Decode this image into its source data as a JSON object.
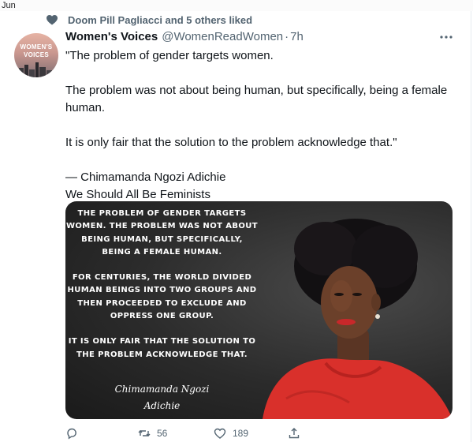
{
  "topbar": {
    "label": "Jun"
  },
  "social_context": {
    "icon": "heart-icon",
    "text": "Doom Pill Pagliacci and 5 others liked"
  },
  "avatar": {
    "title_line1": "WOMEN'S",
    "title_line2": "VOICES"
  },
  "tweet": {
    "author_name": "Women's Voices",
    "handle": "@WomenReadWomen",
    "separator": "·",
    "time": "7h",
    "paragraphs": [
      "\"The problem of gender targets women.",
      "The problem was not about being human, but specifically, being a female human.",
      "It is only fair that the solution to the problem acknowledge that.\"",
      "— Chimamanda Ngozi Adichie",
      "We Should All Be Feminists"
    ]
  },
  "media": {
    "quote_lines": [
      "THE PROBLEM OF GENDER TARGETS WOMEN. THE PROBLEM WAS NOT ABOUT BEING HUMAN, BUT SPECIFICALLY, BEING A FEMALE HUMAN.",
      "FOR CENTURIES, THE WORLD DIVIDED HUMAN BEINGS INTO TWO GROUPS AND THEN PROCEEDED TO EXCLUDE AND OPPRESS ONE GROUP.",
      "IT IS ONLY FAIR THAT THE SOLUTION TO THE PROBLEM ACKNOWLEDGE THAT."
    ],
    "signature_line1": "Chimamanda Ngozi",
    "signature_line2": "Adichie"
  },
  "actions": {
    "reply_count": "",
    "retweet_count": "56",
    "like_count": "189"
  },
  "colors": {
    "muted": "#536471",
    "text": "#0f1419",
    "dress": "#d9302b"
  }
}
